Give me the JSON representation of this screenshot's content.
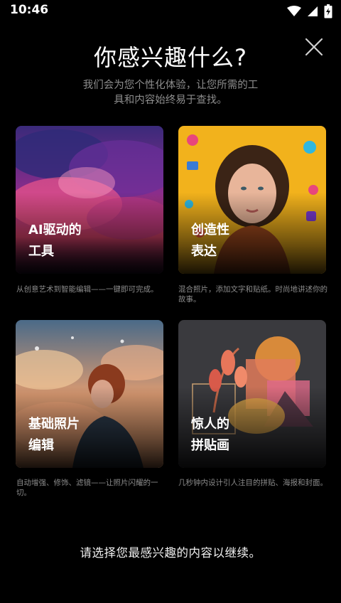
{
  "status": {
    "time": "10:46"
  },
  "header": {
    "title": "你感兴趣什么?",
    "subtitle": "我们会为您个性化体验，让您所需的工具和内容始终易于查找。"
  },
  "cards": [
    {
      "title": "AI驱动的\n工具",
      "desc": "从创意艺术到智能编辑——一键即可完成。"
    },
    {
      "title": "创造性\n表达",
      "desc": "混合照片，添加文字和贴纸。时尚地讲述你的故事。"
    },
    {
      "title": "基础照片\n编辑",
      "desc": "自动增强、修饰、滤镜——让照片闪耀的一切。"
    },
    {
      "title": "惊人的\n拼贴画",
      "desc": "几秒钟内设计引人注目的拼贴、海报和封面。"
    }
  ],
  "footer": {
    "prompt": "请选择您最感兴趣的内容以继续。"
  },
  "icons": {
    "wifi": "wifi-icon",
    "signal": "signal-icon",
    "battery": "battery-charging-icon",
    "close": "close-icon"
  },
  "colors": {
    "background": "#000000",
    "muted_text": "#8d8d8d"
  }
}
